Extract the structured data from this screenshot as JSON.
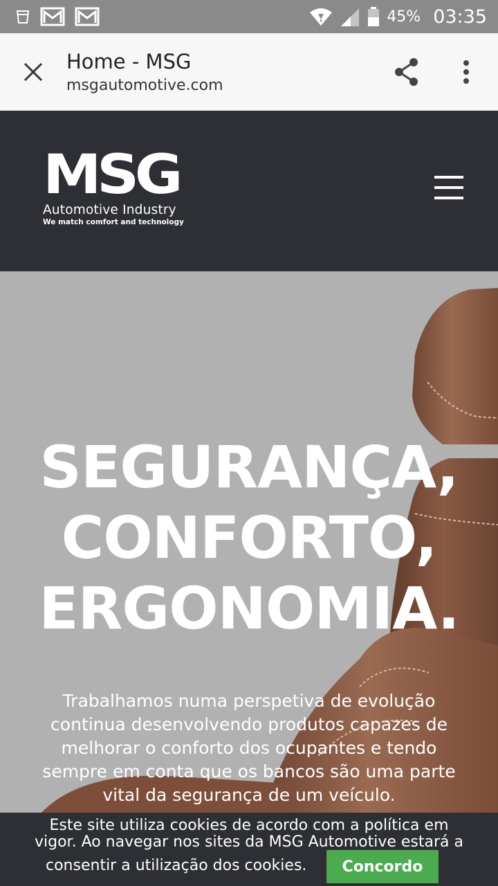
{
  "status_bar": {
    "icons": [
      "cup-icon",
      "gmail-icon",
      "gmail-icon",
      "wifi-icon",
      "signal-icon",
      "battery-icon"
    ],
    "battery": "45%",
    "time": "03:35"
  },
  "browser": {
    "title": "Home - MSG",
    "url": "msgautomotive.com",
    "icons": [
      "close-icon",
      "share-icon",
      "more-vert-icon"
    ]
  },
  "site_header": {
    "logo_text": "MSG",
    "logo_subtitle": "Automotive  Industry",
    "logo_tagline": "We match comfort and technology",
    "menu_icon": "hamburger-icon"
  },
  "hero": {
    "title_lines": [
      "SEGURANÇA,",
      "CONFORTO,",
      "ERGONOMIA."
    ],
    "paragraph": "Trabalhamos numa perspetiva de evolução continua desenvolvendo produtos capazes de melhorar o conforto dos ocupantes e tendo sempre em conta que os bancos são uma parte vital da segurança de um veículo."
  },
  "cookie_banner": {
    "line1": "Este site utiliza cookies de acordo com a política em",
    "line2": "vigor. Ao navegar nos sites da MSG Automotive estará a",
    "line3": "consentir a utilização dos cookies.",
    "accept_label": "Concordo"
  },
  "colors": {
    "status_bar": "#8a8a8a",
    "header_bg": "#2e2f34",
    "hero_bg": "#b1b1b1",
    "accept_button": "#4aac4f",
    "leather": "#8a5a43"
  }
}
